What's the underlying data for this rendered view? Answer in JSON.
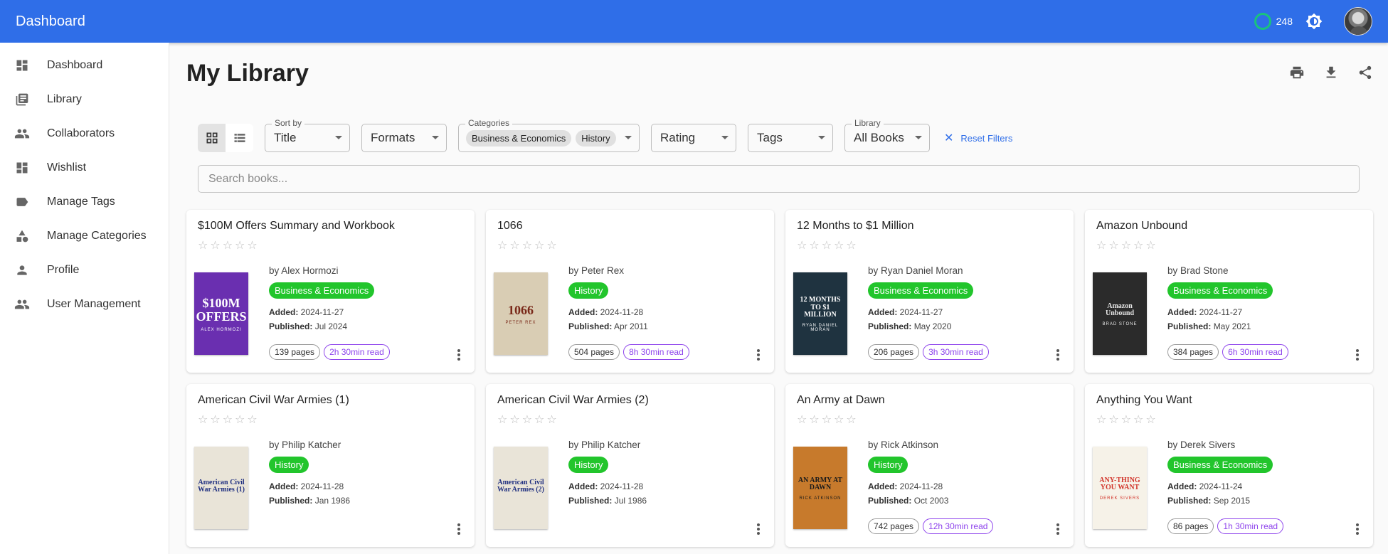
{
  "app": {
    "title": "Dashboard",
    "counter": "248",
    "colors": {
      "primary": "#2f6ee8",
      "category": "#22c52c",
      "read": "#8e44ec",
      "ring": "#19c37d"
    }
  },
  "sidebar": {
    "items": [
      {
        "label": "Dashboard",
        "icon": "dashboard-icon"
      },
      {
        "label": "Library",
        "icon": "library-icon"
      },
      {
        "label": "Collaborators",
        "icon": "people-icon"
      },
      {
        "label": "Wishlist",
        "icon": "dashboard-icon"
      },
      {
        "label": "Manage Tags",
        "icon": "tag-icon"
      },
      {
        "label": "Manage Categories",
        "icon": "shapes-icon"
      },
      {
        "label": "Profile",
        "icon": "person-icon"
      },
      {
        "label": "User Management",
        "icon": "people-icon"
      }
    ]
  },
  "main": {
    "title": "My Library",
    "filters": {
      "sort_label": "Sort by",
      "sort_value": "Title",
      "formats": "Formats",
      "categories_label": "Categories",
      "categories": [
        "Business & Economics",
        "History"
      ],
      "rating": "Rating",
      "tags": "Tags",
      "library_label": "Library",
      "library_value": "All Books",
      "reset": "Reset Filters"
    },
    "search": {
      "placeholder": "Search books..."
    },
    "books": [
      {
        "title": "$100M Offers Summary and Workbook",
        "author": "by Alex Hormozi",
        "category": "Business & Economics",
        "added": "2024-11-27",
        "published": "Jul 2024",
        "pages": "139 pages",
        "read": "2h 30min read"
      },
      {
        "title": "1066",
        "author": "by Peter Rex",
        "category": "History",
        "added": "2024-11-28",
        "published": "Apr 2011",
        "pages": "504 pages",
        "read": "8h 30min read"
      },
      {
        "title": "12 Months to $1 Million",
        "author": "by Ryan Daniel Moran",
        "category": "Business & Economics",
        "added": "2024-11-27",
        "published": "May 2020",
        "pages": "206 pages",
        "read": "3h 30min read"
      },
      {
        "title": "Amazon Unbound",
        "author": "by Brad Stone",
        "category": "Business & Economics",
        "added": "2024-11-27",
        "published": "May 2021",
        "pages": "384 pages",
        "read": "6h 30min read"
      },
      {
        "title": "American Civil War Armies (1)",
        "author": "by Philip Katcher",
        "category": "History",
        "added": "2024-11-28",
        "published": "Jan 1986",
        "pages": "",
        "read": ""
      },
      {
        "title": "American Civil War Armies (2)",
        "author": "by Philip Katcher",
        "category": "History",
        "added": "2024-11-28",
        "published": "Jul 1986",
        "pages": "",
        "read": ""
      },
      {
        "title": "An Army at Dawn",
        "author": "by Rick Atkinson",
        "category": "History",
        "added": "2024-11-28",
        "published": "Oct 2003",
        "pages": "742 pages",
        "read": "12h 30min read"
      },
      {
        "title": "Anything You Want",
        "author": "by Derek Sivers",
        "category": "Business & Economics",
        "added": "2024-11-24",
        "published": "Sep 2015",
        "pages": "86 pages",
        "read": "1h 30min read"
      }
    ],
    "labels": {
      "added": "Added:",
      "published": "Published:"
    },
    "covers": [
      {
        "text": "$100M OFFERS",
        "author": "ALEX HORMOZI",
        "bg": "#6a2fb0",
        "fg": "#ffffff"
      },
      {
        "text": "1066",
        "author": "PETER REX",
        "bg": "#d9cdb4",
        "fg": "#7a2a1a"
      },
      {
        "text": "12 MONTHS TO $1 MILLION",
        "author": "RYAN DANIEL MORAN",
        "bg": "#1f3340",
        "fg": "#ffffff"
      },
      {
        "text": "Amazon Unbound",
        "author": "BRAD STONE",
        "bg": "#2b2b2b",
        "fg": "#e8e8e8"
      },
      {
        "text": "American Civil War Armies (1)",
        "author": "",
        "bg": "#e9e4d8",
        "fg": "#1f2f80"
      },
      {
        "text": "American Civil War Armies (2)",
        "author": "",
        "bg": "#e9e4d8",
        "fg": "#1f2f80"
      },
      {
        "text": "AN ARMY AT DAWN",
        "author": "RICK ATKINSON",
        "bg": "#c77a2c",
        "fg": "#1a1a1a"
      },
      {
        "text": "ANY-THING YOU WANT",
        "author": "DEREK SIVERS",
        "bg": "#f6f2e8",
        "fg": "#d2342a"
      }
    ]
  }
}
